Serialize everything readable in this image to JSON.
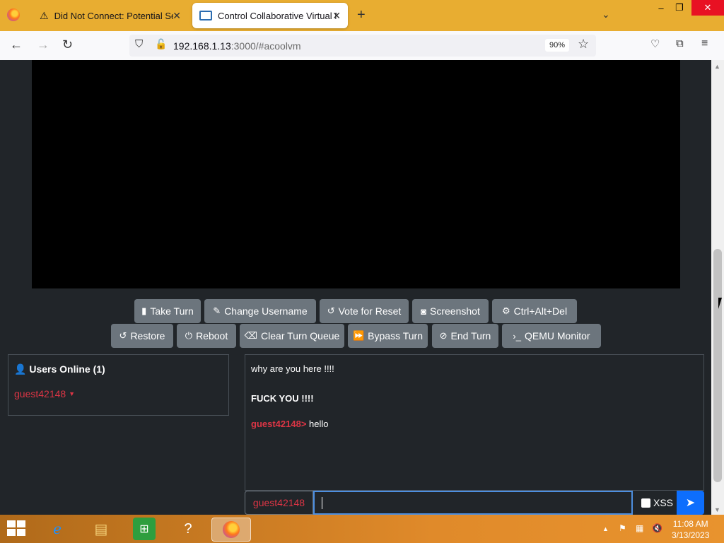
{
  "browser": {
    "tabs": [
      {
        "label": "Did Not Connect: Potential Security Issue",
        "active": false
      },
      {
        "label": "Control Collaborative Virtual Machine",
        "active": true
      }
    ],
    "new_tab": "+",
    "url_host": "192.168.1.13",
    "url_path": ":3000/#acoolvm",
    "zoom": "90%",
    "win_min": "–",
    "win_max": "❐",
    "win_close": "✕"
  },
  "toolbar": {
    "row1": [
      {
        "label": "Take Turn",
        "icon": "mouse-icon"
      },
      {
        "label": "Change Username",
        "icon": "user-edit-icon"
      },
      {
        "label": "Vote for Reset",
        "icon": "undo-icon"
      },
      {
        "label": "Screenshot",
        "icon": "camera-icon"
      },
      {
        "label": "Ctrl+Alt+Del",
        "icon": "gear-icon"
      }
    ],
    "row2": [
      {
        "label": "Restore",
        "icon": "undo-icon"
      },
      {
        "label": "Reboot",
        "icon": "power-icon"
      },
      {
        "label": "Clear Turn Queue",
        "icon": "eraser-icon"
      },
      {
        "label": "Bypass Turn",
        "icon": "fast-forward-icon"
      },
      {
        "label": "End Turn",
        "icon": "ban-icon"
      },
      {
        "label": "QEMU Monitor",
        "icon": "terminal-icon"
      }
    ]
  },
  "users": {
    "title": "Users Online (1)",
    "list": [
      "guest42148"
    ]
  },
  "chat": {
    "messages": [
      {
        "text": "why are you here !!!!",
        "bold": false
      },
      {
        "text": "FUCK YOU !!!!",
        "bold": true
      },
      {
        "user": "guest42148>",
        "text": "hello"
      }
    ],
    "username": "guest42148",
    "input_value": "",
    "xss_label": "XSS"
  },
  "taskbar": {
    "time": "11:08 AM",
    "date": "3/13/2023"
  },
  "colors": {
    "page_bg": "#212529",
    "button": "#6c757d",
    "accent_red": "#dc3545",
    "send_blue": "#0d6efd"
  }
}
